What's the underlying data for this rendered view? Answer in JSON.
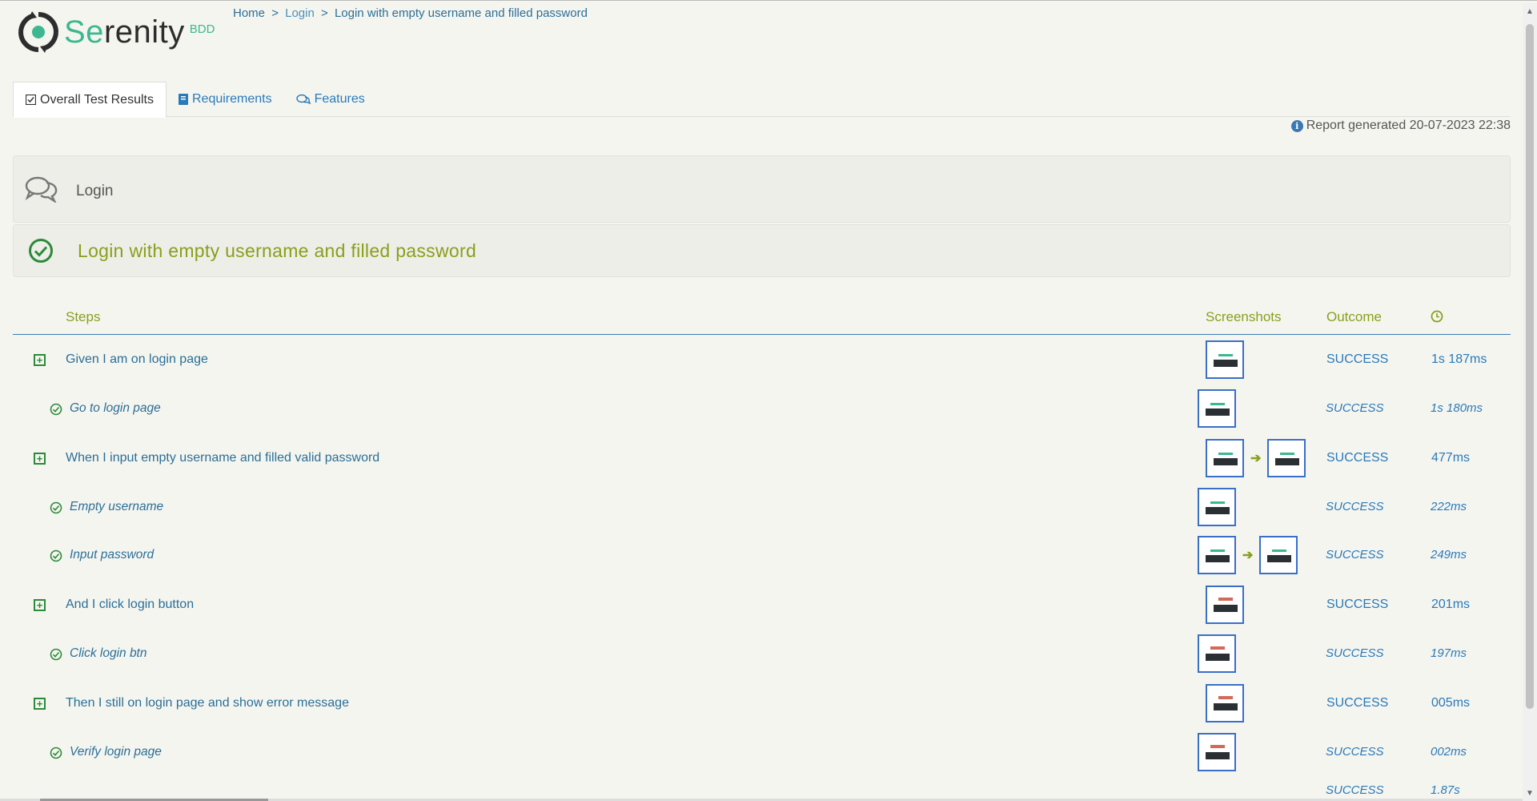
{
  "brand": {
    "logo_main_prefix": "Se",
    "logo_main_suffix": "renity",
    "logo_sub": "BDD"
  },
  "breadcrumb": {
    "home": "Home",
    "login": "Login",
    "current": "Login with empty username and filled password",
    "separator": ">"
  },
  "tabs": [
    {
      "label": "Overall Test Results",
      "icon": "checkbox-icon",
      "active": true
    },
    {
      "label": "Requirements",
      "icon": "book-icon",
      "active": false
    },
    {
      "label": "Features",
      "icon": "comments-icon",
      "active": false
    }
  ],
  "report": {
    "generated": "Report generated 20-07-2023 22:38"
  },
  "feature": {
    "name": "Login"
  },
  "scenario": {
    "title": "Login with empty username and filled password",
    "status_color": "#8a9e1c"
  },
  "table": {
    "headers": {
      "steps": "Steps",
      "screenshots": "Screenshots",
      "outcome": "Outcome",
      "duration_icon": "clock-icon"
    },
    "rows": [
      {
        "kind": "step",
        "text": "Given I am on login page",
        "outcome": "SUCCESS",
        "duration": "1s 187ms",
        "shots": 1
      },
      {
        "kind": "sub",
        "text": "Go to login page",
        "outcome": "SUCCESS",
        "duration": "1s 180ms",
        "shots": 1
      },
      {
        "kind": "step",
        "text": "When I input empty username and filled valid password",
        "outcome": "SUCCESS",
        "duration": "477ms",
        "shots": 2
      },
      {
        "kind": "sub",
        "text": "Empty username",
        "outcome": "SUCCESS",
        "duration": "222ms",
        "shots": 1
      },
      {
        "kind": "sub",
        "text": "Input password",
        "outcome": "SUCCESS",
        "duration": "249ms",
        "shots": 2
      },
      {
        "kind": "step",
        "text": "And I click login button",
        "outcome": "SUCCESS",
        "duration": "201ms",
        "shots": 1
      },
      {
        "kind": "sub",
        "text": "Click login btn",
        "outcome": "SUCCESS",
        "duration": "197ms",
        "shots": 1
      },
      {
        "kind": "step",
        "text": "Then I still on login page and show error message",
        "outcome": "SUCCESS",
        "duration": "005ms",
        "shots": 1
      },
      {
        "kind": "sub",
        "text": "Verify login page",
        "outcome": "SUCCESS",
        "duration": "002ms",
        "shots": 1
      }
    ],
    "partial_row": {
      "outcome": "SUCCESS",
      "duration": "1.87s"
    }
  },
  "colors": {
    "accent_green": "#3cb890",
    "link_blue": "#2a6f97",
    "olive": "#8a9e1c",
    "success_green": "#2c8a3a"
  }
}
